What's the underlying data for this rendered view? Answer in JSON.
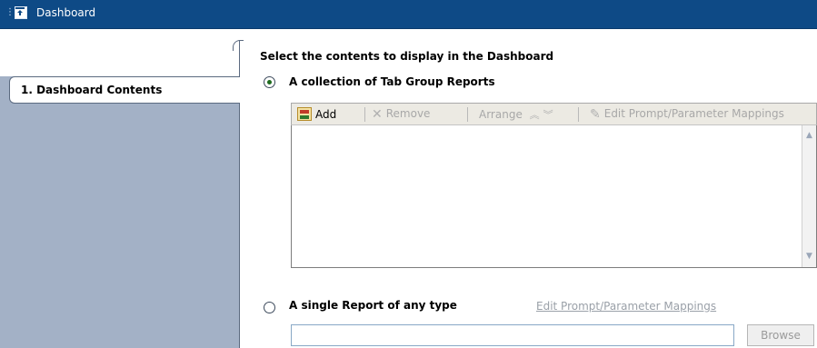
{
  "window": {
    "title": "Dashboard",
    "icon": "dashboard-app-icon"
  },
  "sidebar": {
    "steps": [
      {
        "label": "1. Dashboard Contents",
        "selected": true
      }
    ]
  },
  "content": {
    "heading": "Select the contents to display in the Dashboard",
    "option_collection": {
      "label": "A collection of Tab Group Reports",
      "checked": true
    },
    "option_single": {
      "label": "A single Report of any type",
      "checked": false
    },
    "toolbar": {
      "add": "Add",
      "remove": "Remove",
      "arrange": "Arrange",
      "edit_mappings": "Edit Prompt/Parameter Mappings"
    },
    "list_items": [],
    "single_edit_mappings": "Edit Prompt/Parameter Mappings",
    "report_input_value": "",
    "browse": "Browse"
  },
  "colors": {
    "titlebar": "#0e4a86",
    "sidebar": "#a3b1c6",
    "disabled_text": "#a8a8a8"
  }
}
